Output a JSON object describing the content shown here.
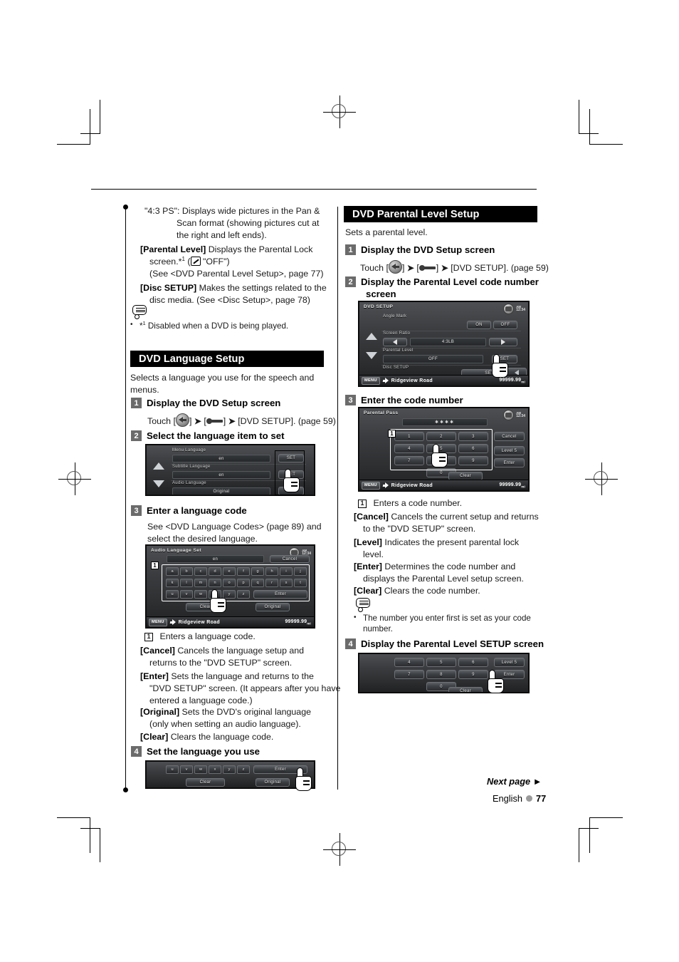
{
  "page": {
    "footer_next": "Next page ►",
    "footer_language": "English",
    "footer_number": "77"
  },
  "left_column": {
    "intro": {
      "line1": "\"4:3 PS\": Displays wide pictures in the Pan &",
      "line2": "Scan format (showing pictures cut at",
      "line3": "the right and left ends).",
      "parental_label": "[Parental Level]",
      "parental_desc": "Displays the Parental Lock",
      "parental_desc2_pre": "screen.*",
      "parental_desc2_sup": "1",
      "parental_desc2_post": "\"OFF\")",
      "parental_see": "(See <DVD Parental Level Setup>, page 77)",
      "disc_label": "[Disc SETUP]",
      "disc_desc": "Makes the settings related to the",
      "disc_desc2": "disc media. (See <Disc Setup>, page 78)",
      "note_bullet": "•",
      "note_text_pre": "*",
      "note_text_sup": "1",
      "note_text": " Disabled when a DVD is being played."
    },
    "section": {
      "title": "DVD Language Setup",
      "lead1": "Selects a language you use for the speech and",
      "lead2": "menus."
    },
    "step1": {
      "num": "1",
      "title": "Display the DVD Setup screen",
      "touch_pre": "Touch [",
      "touch_mid": "] ",
      "touch_gt": "➤",
      "touch_b2": " [",
      "touch_end": "] ",
      "touch_dvd": "[DVD SETUP]. (page 59)"
    },
    "step2": {
      "num": "2",
      "title": "Select the language item to set",
      "screen": {
        "rows": [
          {
            "label": "Menu Language",
            "value": "en",
            "button": "SET"
          },
          {
            "label": "Subtitle Language",
            "value": "en",
            "button": "SET"
          },
          {
            "label": "Audio Language",
            "value": "Original",
            "button": "SET"
          }
        ]
      }
    },
    "step3": {
      "num": "3",
      "title": "Enter a language code",
      "body1": "See <DVD Language Codes> (page 89) and",
      "body2": "select the desired language.",
      "screen": {
        "title": "Audio Language Set",
        "time_am": "AM",
        "time": "12:34",
        "code_value": "en",
        "cancel": "Cancel",
        "marker": "1",
        "row1": [
          "a",
          "b",
          "c",
          "d",
          "e",
          "f",
          "g",
          "h",
          "i",
          "j"
        ],
        "row2": [
          "k",
          "l",
          "m",
          "n",
          "o",
          "p",
          "q",
          "r",
          "s",
          "t"
        ],
        "row3": [
          "u",
          "v",
          "w",
          "x",
          "y",
          "z"
        ],
        "enter": "Enter",
        "clear": "Clear",
        "original": "Original",
        "menu": "MENU",
        "road": "Ridgeview Road",
        "distance": "99999.99",
        "distance_unit": "mi"
      },
      "notes": [
        {
          "marker": "1",
          "text": "Enters a language code."
        },
        {
          "label": "[Cancel]",
          "text": "Cancels the language setup and",
          "text2": "returns to the \"DVD SETUP\" screen."
        },
        {
          "label": "[Enter]",
          "text": "Sets the language and returns to the",
          "text2": "\"DVD SETUP\" screen. (It appears after you have",
          "text3": "entered a language code.)"
        },
        {
          "label": "[Original]",
          "text": "Sets the DVD's original language",
          "text2": "(only when setting an audio language)."
        },
        {
          "label": "[Clear]",
          "text": "Clears the language code."
        }
      ]
    },
    "step4": {
      "num": "4",
      "title": "Set the language you use",
      "screen": {
        "row3": [
          "u",
          "v",
          "w",
          "x",
          "y",
          "z"
        ],
        "enter": "Enter",
        "clear": "Clear",
        "original": "Original"
      }
    }
  },
  "right_column": {
    "section": {
      "title": "DVD Parental Level Setup",
      "lead": "Sets a parental level."
    },
    "step1": {
      "num": "1",
      "title": "Display the DVD Setup screen",
      "touch_pre": "Touch [",
      "touch_dvd": "[DVD SETUP]. (page 59)"
    },
    "step2": {
      "num": "2",
      "title1": "Display the Parental Level code number",
      "title2": "screen",
      "screen": {
        "title": "DVD SETUP",
        "time_am": "AM",
        "time": "12:34",
        "rows": [
          {
            "label": "Angle Mark",
            "on": "ON",
            "off": "OFF"
          },
          {
            "label": "Screen Ratio",
            "value": "4:3LB"
          },
          {
            "label": "Parental Level",
            "value": "OFF",
            "button": "SET"
          },
          {
            "label": "Disc SETUP",
            "button": "SET"
          }
        ],
        "menu": "MENU",
        "road": "Ridgeview Road",
        "distance": "99999.99",
        "distance_unit": "mi"
      }
    },
    "step3": {
      "num": "3",
      "title": "Enter the code number",
      "screen": {
        "title": "Parental Pass",
        "time_am": "AM",
        "time": "12:34",
        "pass_value": "✱✱✱✱",
        "marker": "1",
        "keys": [
          "1",
          "2",
          "3",
          "4",
          "5",
          "6",
          "7",
          "8",
          "9",
          "0"
        ],
        "cancel": "Cancel",
        "level": "Level 5",
        "enter": "Enter",
        "clear": "Clear",
        "menu": "MENU",
        "road": "Ridgeview Road",
        "distance": "99999.99",
        "distance_unit": "mi"
      },
      "notes": [
        {
          "marker": "1",
          "text": "Enters a code number."
        },
        {
          "label": "[Cancel]",
          "text": "Cancels the current setup and returns",
          "text2": "to the \"DVD SETUP\" screen."
        },
        {
          "label": "[Level]",
          "text": "Indicates the present parental lock",
          "text2": "level."
        },
        {
          "label": "[Enter]",
          "text": "Determines the code number and",
          "text2": "displays the Parental Level setup screen."
        },
        {
          "label": "[Clear]",
          "text": "Clears the code number."
        }
      ],
      "tip_bullet": "•",
      "tip1": "The number you enter first is set as your code",
      "tip2": "number."
    },
    "step4": {
      "num": "4",
      "title": "Display the Parental Level SETUP screen",
      "screen": {
        "keys": [
          "4",
          "5",
          "6",
          "7",
          "8",
          "9",
          "0"
        ],
        "level": "Level 5",
        "enter": "Enter",
        "clear": "Clear"
      }
    }
  }
}
